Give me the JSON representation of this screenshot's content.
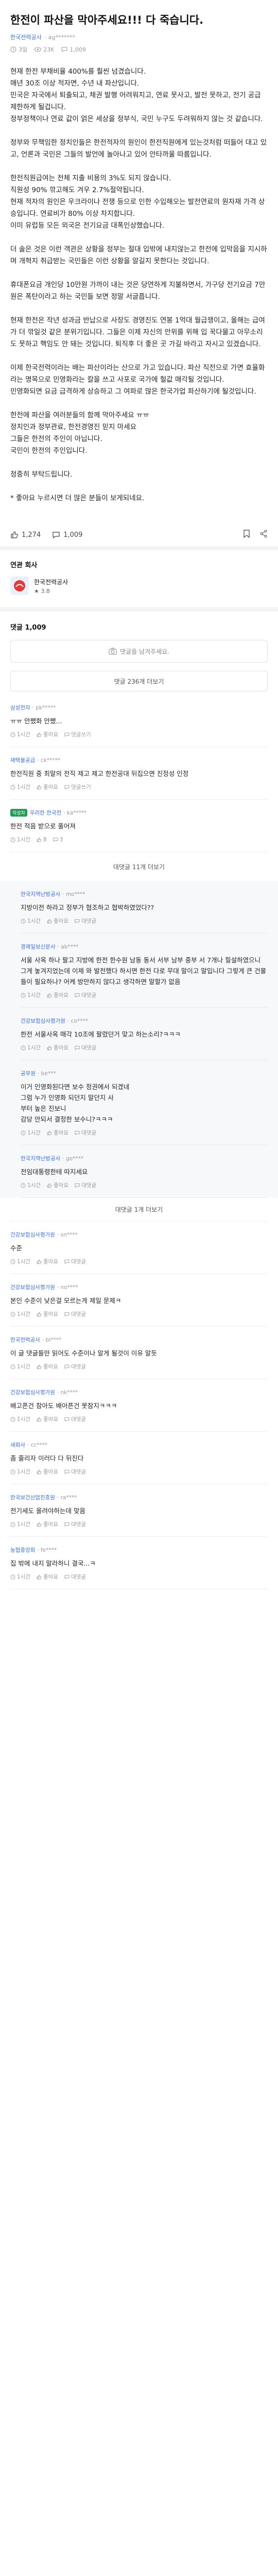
{
  "post": {
    "title": "한전이 파산을 막아주세요!!! 다 죽습니다.",
    "company": "한국전력공사",
    "author": "· ag*******",
    "time": "3일",
    "views": "23K",
    "comments": "1,009",
    "paragraphs": [
      "현재 한전 부채비율 400%를 훨씬 넘겼습니다.\n매년 30조 이상 적자면, 수년 내 파산입니다.\n민국은 자국에서 퇴출되고, 채권 발행 어려워지고, 연료 못사고, 발전 못하고, 전기 공급 제한하게 될겁니다.\n정부정책이나 연료 값이 얽은 세상을 정부식, 국민 누구도 두려워하지 않는 것 같습니다.",
      "정부와 무책임한 정치인들은 한전적자의 원인이 한전직원에게 있는것처럼 떠들어 대고 있고, 언론과 국민은 그들의 발언에 놀아나고 있어 안타까울 따름입니다.",
      "한전직원급여는 전체 지출 비용의 3%도 되지 않습니다.\n직원성 90% 깎고해도 겨우 2.7%절약됩니다.\n현재 적자의 원인은 우크라이나 전쟁 등으로 인한 수입해오는 발전연료의 원자재 가격 상승입니다. 연료비가 80% 이상 차지합니다.\n이미 유럽등 모든 외국은 전기요금 대폭인상했습니다.",
      "더 솔은 것은 이런 객관은 상황을 정부는 절대 입밖에 내지않는고 한전에 입막음을 지시하며 개혁지 취급받는 국민들은 이런 상황을 알길지 못한다는 것입니다.",
      "휴대폰요금 개인당 10만원 가까이 내는 것은 당연하게 지불하면서, 가구당 전기요금 7만원은 폭탄이라고 하는 국민들 보면 정말 서글픕니다.",
      "현재 한전은 작년 성과금 반납으로 사장도 경영진도 연봉 1억대 월급쟁이고, 올해는 급여가 더 깎일것 같은 분위기입니다. 그들은 이제 자신의 안위를 위해 입 꾹다물고 아무소리도 못하고 핵임도 안 돼는 것입니다. 퇴직후 더 좋은 곳 가길 바라고 자시고 있겠습니다.",
      "이제 한국전력이라는 배는 파산이라는 산으로 가고 있습니다. 파산 직전으로 가면 효율화라는 명목으로 민영화라는 칼을 쓰고 사포로 국가에 헐값 매각될 것입니다.\n민영화되면 요금 급격하게 상승하고 그 여파로 많은 한국가업 파산하기에 될것입니다.",
      "한전에 파산을 여러분들의 함께 막아주세요 ㅠㅠ\n정치인과 정부관료, 한전경영진 믿지 마세요\n그들은 한전의 주인이 아닙니다.\n국민이 한전의 주인입니다.",
      "정중히 부탁드립니다.",
      "* 좋아요 누르시면 더 많은 분들이 보게되네요."
    ]
  },
  "reactions": {
    "likes": "1,274",
    "comments": "1,009"
  },
  "related": {
    "title": "연관 회사",
    "company_name": "한국전력공사",
    "rating": "★ 3.8"
  },
  "comments_section": {
    "count_label": "댓글 1,009",
    "input_placeholder": "댓글을 남겨주세요.",
    "more_label": "댓글 236개 더보기",
    "items": [
      {
        "company": "삼성전자",
        "author": "· pk*****",
        "text": "ㅠㅠ 안쨌화 안쨌...",
        "time": "1시간",
        "likes": "좋아요",
        "reply": "댓글쓰기"
      },
      {
        "company": "재택물공급",
        "author": "· ck*****",
        "text": "한전직원 중 최말의 전직 제고 제고 한전공대 뒤집으면 진정성 인정",
        "time": "1시간",
        "likes": "좋아요",
        "reply": "댓글쓰기"
      },
      {
        "company": "우리한 한국전",
        "author": "· ka*****",
        "badge": "작성자",
        "text": "한전 적음 받으로 풀어져",
        "time": "1시간",
        "likes": "8",
        "reply": "3"
      }
    ],
    "replies_more_1": "대댓글 11개 더보기",
    "replies": [
      {
        "company": "한국지역난방공사",
        "author": "· mo****",
        "text": "지방이전 하라고 정부가 협조하고 협박하였었다??",
        "time": "1시간",
        "likes": "좋아요",
        "reply": "대댓글"
      },
      {
        "company": "경제일보신문사",
        "author": "· ab****",
        "text": "서울 사옥 하나 팔고 지방에 한전 한수원 남동 동서 서부 남부 중부 서 7개나 힐설하였으니 그게 놓겨지었는데 이제 와 발전했다 하시면 한전 다로 무대 말이고 말입니다 그렇게 큰 건물들이 필요하나? 어케 방만하지 않다고 생각하면 말할가 없음",
        "time": "1시간",
        "likes": "좋아요",
        "reply": "대댓글"
      },
      {
        "company": "건강보험심사평가원",
        "author": "· co****",
        "text": "한전 서울사옥 매각 10조에 팔렸던거 맞고 하는소리?ㅋㅋㅋ",
        "time": "1시간",
        "likes": "좋아요",
        "reply": "대댓글"
      },
      {
        "company": "공무원",
        "author": "· be***",
        "text": "이거 인영화된다면 보수 정권에서 되겠네\n그럼 누가 인영화 되던지 말던지 사\n부터 높은 진보니\n감당 안되서 결정한 보수니?ㅋㅋㅋ",
        "time": "1시간",
        "likes": "좋아요",
        "reply": "대댓글"
      },
      {
        "company": "한국지역난방공사",
        "author": "· go****",
        "text": "전임대통령한테 따지세요",
        "time": "1시간",
        "likes": "좋아요",
        "reply": "대댓글"
      }
    ],
    "replies_more_2": "대댓글 1개 더보기",
    "bottom_items": [
      {
        "company": "건강보험심사평가원",
        "author": "· sn****",
        "text": "수준",
        "time": "1시간",
        "likes": "좋아요",
        "reply": "대댓글"
      },
      {
        "company": "건강보험심사평가원",
        "author": "· no****",
        "text": "본인 수준이 낮은걸 모르는게 제일 문제ㅋ",
        "time": "1시간",
        "likes": "좋아요",
        "reply": "대댓글"
      },
      {
        "company": "한국전력공사",
        "author": "· bi****",
        "text": "이 글 댓글들만 읽어도 수준이나 알게 될것이 이유 알듯",
        "time": "1시간",
        "likes": "좋아요",
        "reply": "대댓글"
      },
      {
        "company": "건강보험심사평가원",
        "author": "· nk****",
        "text": "배고픈건 참아도 배아픈건 못참지ㅋㅋㅋ",
        "time": "1시간",
        "likes": "좋아요",
        "reply": "대댓글"
      },
      {
        "company": "새회사",
        "author": "· cc****",
        "text": "좀 줄리자 이러다 다 뒤진다",
        "time": "1시간",
        "likes": "좋아요",
        "reply": "대댓글"
      },
      {
        "company": "한국보건산업진흥원",
        "author": "· ra****",
        "text": "전기세도 올려야하는데 맞음",
        "time": "1시간",
        "likes": "좋아요",
        "reply": "대댓글"
      },
      {
        "company": "농협중앙회",
        "author": "· fe****",
        "text": "집 밖에 내지 말라하니 결국...ㅋ",
        "time": "1시간",
        "likes": "좋아요",
        "reply": "대댓글"
      }
    ]
  },
  "colors": {
    "accent": "#3a6fd8",
    "badge": "#1f9d55"
  }
}
